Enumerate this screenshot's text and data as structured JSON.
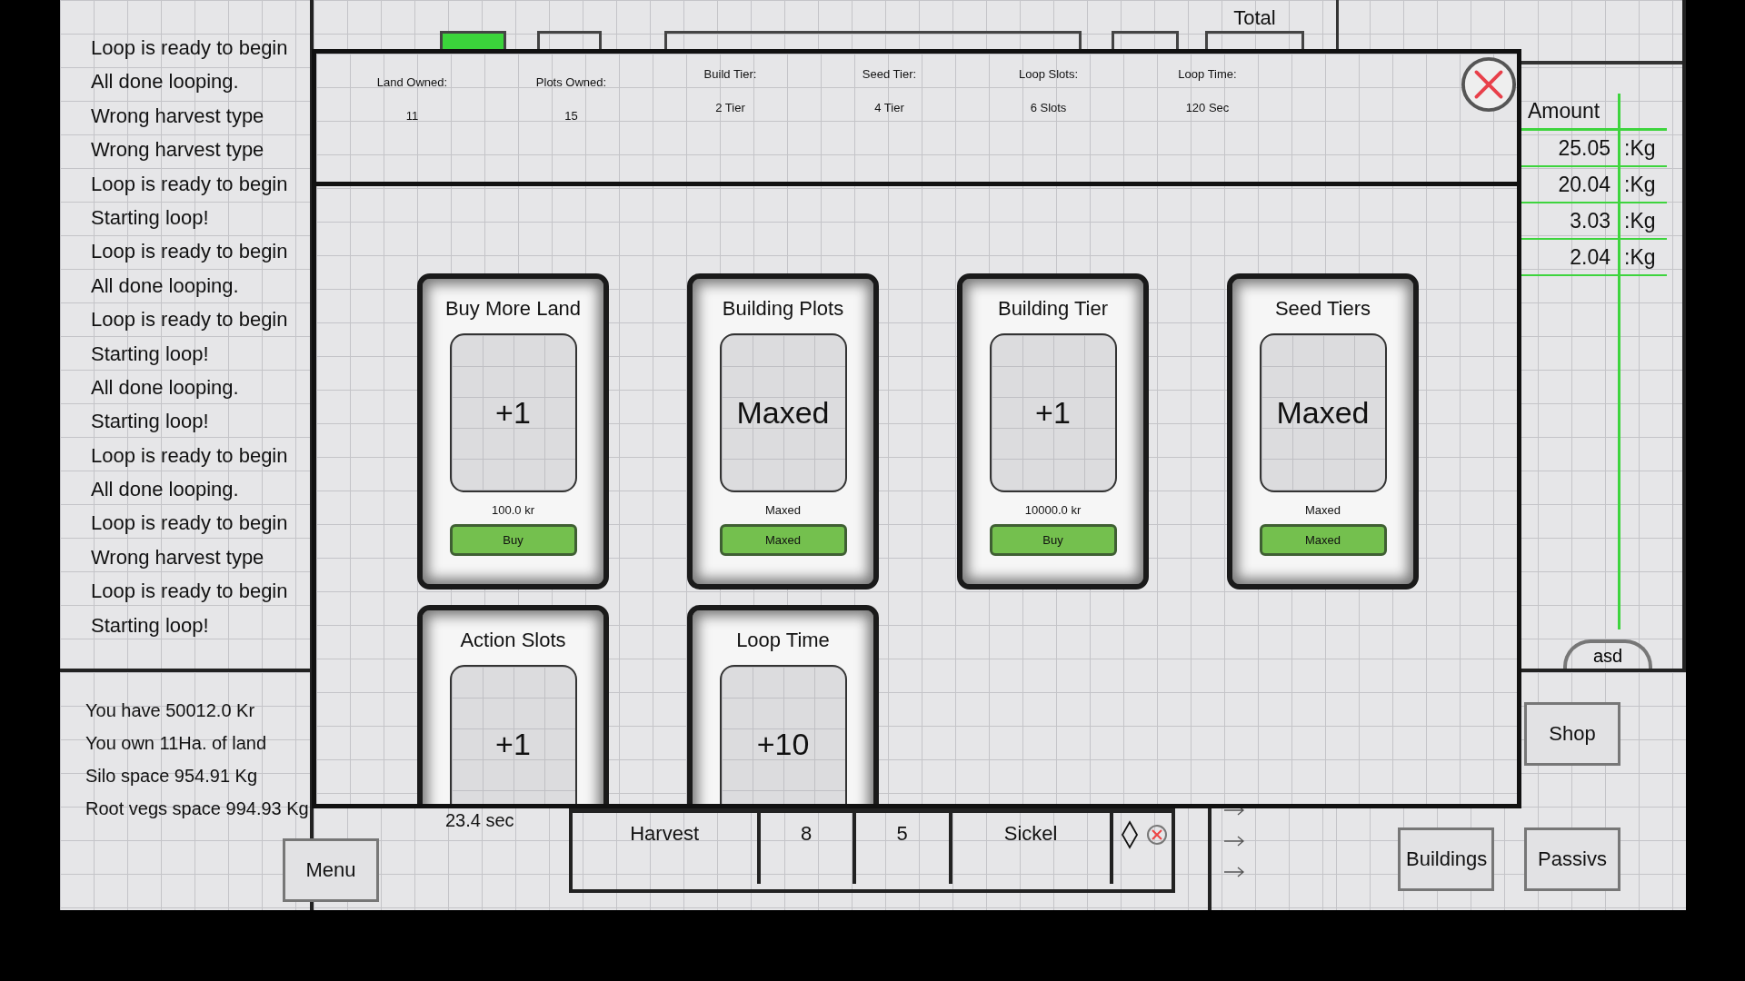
{
  "log": [
    "Loop is ready to begin",
    "All done looping.",
    "Wrong harvest type",
    "Wrong harvest type",
    "Loop is ready to begin",
    "Starting loop!",
    "Loop is ready to begin",
    "All done looping.",
    "Loop is ready to begin",
    "Starting loop!",
    "All done looping.",
    "Starting loop!",
    "Loop is ready to begin",
    "All done looping.",
    "Loop is ready to begin",
    "Wrong harvest type",
    "Loop is ready to begin",
    "Starting loop!"
  ],
  "status": [
    "You have 50012.0 Kr",
    "You own 11Ha. of land",
    "Silo space 954.91 Kg",
    "Root vegs space 994.93 Kg"
  ],
  "menu_button": "Menu",
  "timer": "23.4 sec",
  "total_label": "Total",
  "action_row": {
    "name": "Harvest",
    "column_2": "8",
    "column_3": "5",
    "tool": "Sickel"
  },
  "storage": {
    "header": "Amount",
    "rows": [
      {
        "amount": "25.05",
        "unit": ":Kg"
      },
      {
        "amount": "20.04",
        "unit": ":Kg"
      },
      {
        "amount": "3.03",
        "unit": ":Kg"
      },
      {
        "amount": "2.04",
        "unit": ":Kg"
      }
    ]
  },
  "storage_tabs": [
    "asd"
  ],
  "buttons": {
    "shop": "Shop",
    "buildings": "Buildings",
    "passives": "Passivs"
  },
  "upgrades": {
    "stats": [
      {
        "label": "Land Owned:",
        "value": "11"
      },
      {
        "label": "Plots Owned:",
        "value": "15"
      },
      {
        "label": "Build Tier:",
        "value": "2 Tier"
      },
      {
        "label": "Seed Tier:",
        "value": "4 Tier"
      },
      {
        "label": "Loop Slots:",
        "value": "6 Slots"
      },
      {
        "label": "Loop Time:",
        "value": "120 Sec"
      }
    ],
    "cards": [
      {
        "title": "Buy More Land",
        "effect": "+1",
        "price": "100.0 kr",
        "button": "Buy"
      },
      {
        "title": "Building Plots",
        "effect": "Maxed",
        "price": "Maxed",
        "button": "Maxed"
      },
      {
        "title": "Building Tier",
        "effect": "+1",
        "price": "10000.0 kr",
        "button": "Buy"
      },
      {
        "title": "Seed Tiers",
        "effect": "Maxed",
        "price": "Maxed",
        "button": "Maxed"
      },
      {
        "title": "Action Slots",
        "effect": "+1"
      },
      {
        "title": "Loop Time",
        "effect": "+10"
      }
    ]
  }
}
